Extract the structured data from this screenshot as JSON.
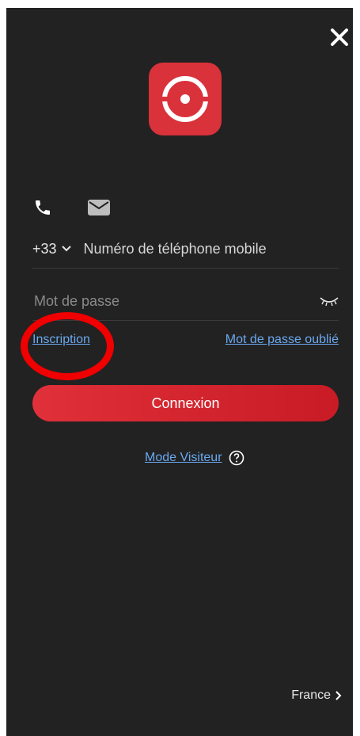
{
  "country_code": "+33",
  "phone_placeholder": "Numéro de téléphone mobile",
  "password_placeholder": "Mot de passe",
  "signup_label": "Inscription",
  "forgot_label": "Mot de passe oublié",
  "login_label": "Connexion",
  "visitor_label": "Mode Visiteur",
  "region_label": "France",
  "icons": {
    "close": "close-icon",
    "logo": "app-logo",
    "phone_tab": "phone-icon",
    "mail_tab": "mail-icon",
    "country_dropdown": "chevron-down-icon",
    "password_toggle": "eye-closed-icon",
    "help": "help-icon",
    "region": "chevron-right-icon"
  },
  "colors": {
    "background": "#222222",
    "accent": "#d9323a",
    "link": "#6aa8f0",
    "annotation": "#f00000"
  }
}
